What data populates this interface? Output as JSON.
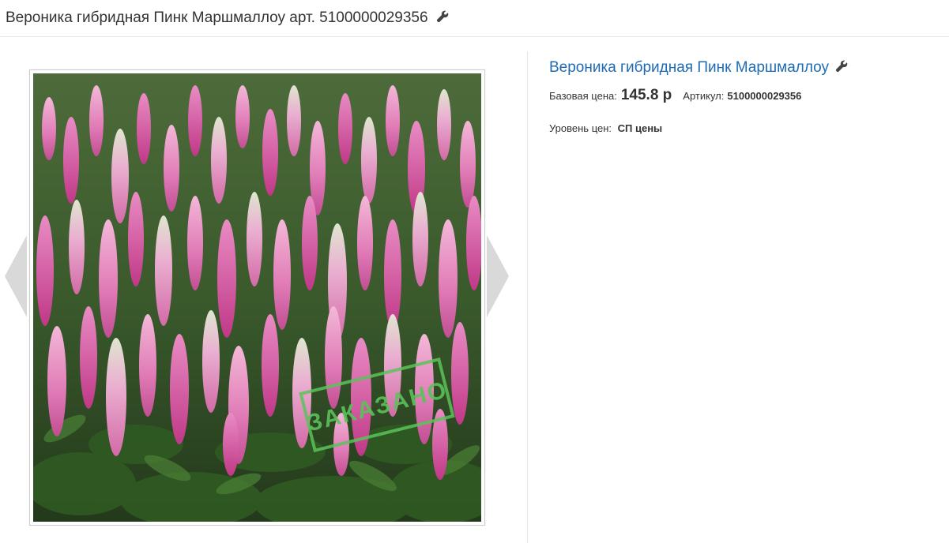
{
  "header": {
    "title": "Вероника гибридная Пинк Маршмаллоу арт. 5100000029356",
    "edit_icon": "wrench-icon"
  },
  "gallery": {
    "prev_icon": "chevron-left-icon",
    "next_icon": "chevron-right-icon",
    "stamp_text": "ЗАКАЗАНО",
    "stamp_color": "#5cc25a"
  },
  "product": {
    "name": "Вероника гибридная Пинк Маршмаллоу",
    "edit_icon": "wrench-icon",
    "base_price_label": "Базовая цена:",
    "base_price_value": "145.8 р",
    "article_label": "Артикул:",
    "article_value": "5100000029356",
    "price_level_label": "Уровень цен:",
    "price_level_value": "СП цены",
    "link_color": "#1e6bb4"
  }
}
